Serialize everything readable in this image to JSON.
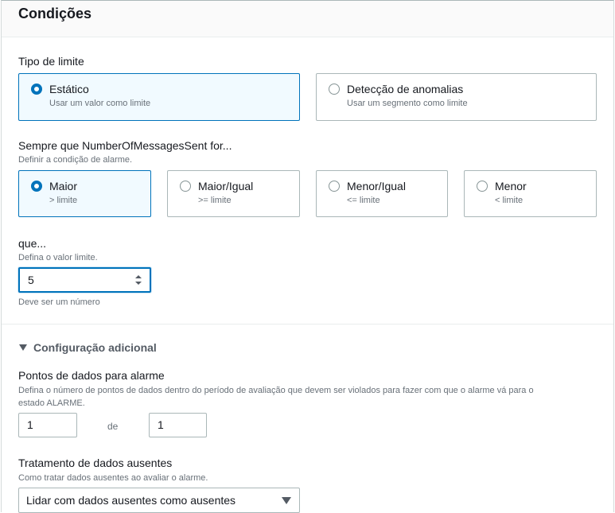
{
  "section": {
    "title": "Condições"
  },
  "threshold_type": {
    "label": "Tipo de limite",
    "options": [
      {
        "title": "Estático",
        "desc": "Usar um valor como limite",
        "selected": true
      },
      {
        "title": "Detecção de anomalias",
        "desc": "Usar um segmento como limite",
        "selected": false
      }
    ]
  },
  "condition": {
    "label": "Sempre que NumberOfMessagesSent for...",
    "desc": "Definir a condição de alarme.",
    "options": [
      {
        "title": "Maior",
        "desc": "> limite",
        "selected": true
      },
      {
        "title": "Maior/Igual",
        "desc": ">= limite",
        "selected": false
      },
      {
        "title": "Menor/Igual",
        "desc": "<= limite",
        "selected": false
      },
      {
        "title": "Menor",
        "desc": "< limite",
        "selected": false
      }
    ]
  },
  "threshold_value": {
    "label": "que...",
    "desc": "Defina o valor limite.",
    "value": "5",
    "hint": "Deve ser um número"
  },
  "additional": {
    "toggle_label": "Configuração adicional",
    "datapoints": {
      "label": "Pontos de dados para alarme",
      "desc_line1": "Defina o número de pontos de dados dentro do período de avaliação que devem ser violados para fazer com que o alarme vá para o",
      "desc_line2": "estado ALARME.",
      "value_a": "1",
      "separator": "de",
      "value_b": "1"
    },
    "missing_data": {
      "label": "Tratamento de dados ausentes",
      "desc": "Como tratar dados ausentes ao avaliar o alarme.",
      "selected": "Lidar com dados ausentes como ausentes"
    }
  },
  "colors": {
    "accent": "#0073bb",
    "selected_bg": "#f1faff",
    "border": "#aab7b8"
  }
}
